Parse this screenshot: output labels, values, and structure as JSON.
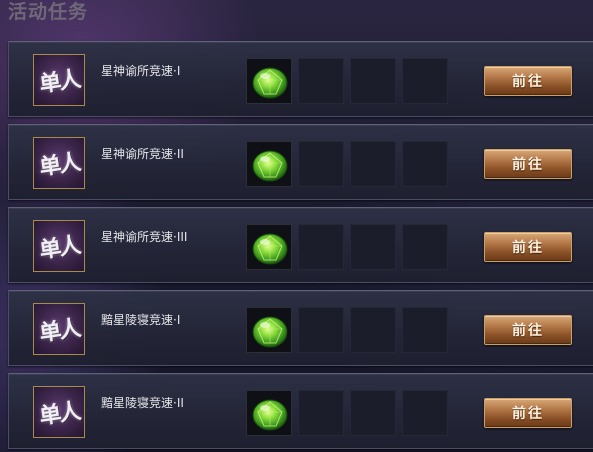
{
  "panel": {
    "title": "活动任务"
  },
  "colors": {
    "button_accent": "#b57a4a",
    "badge_border": "#a88a4a",
    "gem_green": "#6ed23a"
  },
  "tasks": [
    {
      "badge": "单人",
      "name": "星神谕所竞速·I",
      "reward_icon": "green-gem-icon",
      "go_label": "前往"
    },
    {
      "badge": "单人",
      "name": "星神谕所竞速·II",
      "reward_icon": "green-gem-icon",
      "go_label": "前往"
    },
    {
      "badge": "单人",
      "name": "星神谕所竞速·III",
      "reward_icon": "green-gem-icon",
      "go_label": "前往"
    },
    {
      "badge": "单人",
      "name": "黯星陵寝竞速·I",
      "reward_icon": "green-gem-icon",
      "go_label": "前往"
    },
    {
      "badge": "单人",
      "name": "黯星陵寝竞速·II",
      "reward_icon": "green-gem-icon",
      "go_label": "前往"
    }
  ]
}
